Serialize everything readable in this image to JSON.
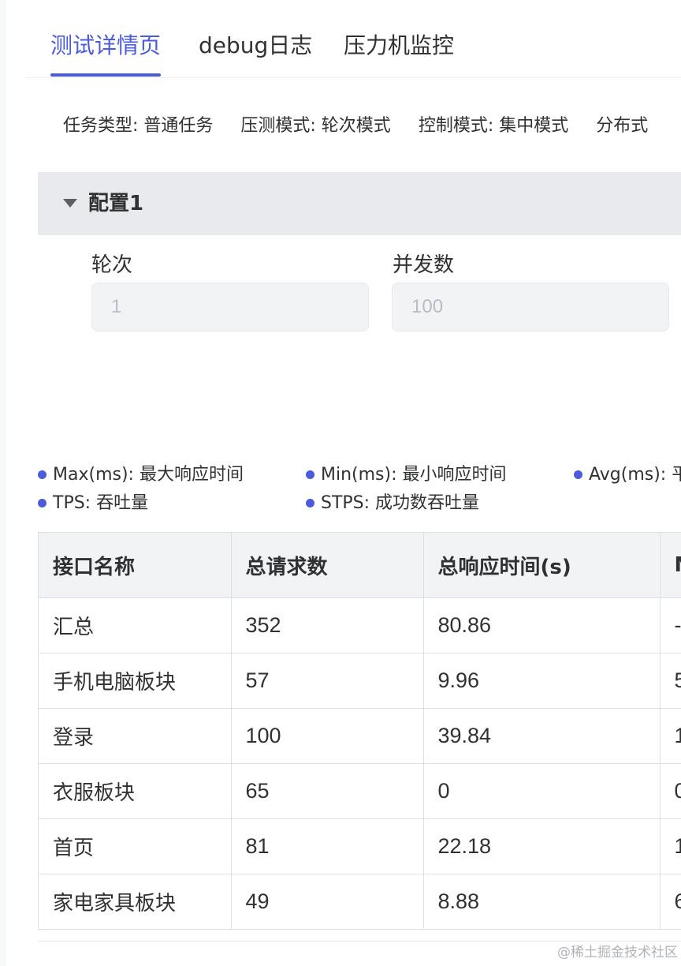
{
  "tabs": [
    {
      "label": "测试详情页",
      "active": true
    },
    {
      "label": "debug日志",
      "active": false
    },
    {
      "label": "压力机监控",
      "active": false
    }
  ],
  "meta": {
    "task_type": "任务类型: 普通任务",
    "load_mode": "压测模式: 轮次模式",
    "control_mode": "控制模式: 集中模式",
    "distribution": "分布式"
  },
  "config": {
    "title": "配置1",
    "rounds_label": "轮次",
    "rounds_value": "1",
    "concurrency_label": "并发数",
    "concurrency_value": "100"
  },
  "legend": [
    "Max(ms): 最大响应时间",
    "Min(ms): 最小响应时间",
    "Avg(ms): 平",
    "TPS: 吞吐量",
    "STPS: 成功数吞吐量"
  ],
  "table": {
    "headers": [
      "接口名称",
      "总请求数",
      "总响应时间(s)",
      "M"
    ],
    "rows": [
      [
        "汇总",
        "352",
        "80.86",
        "-"
      ],
      [
        "手机电脑板块",
        "57",
        "9.96",
        "5"
      ],
      [
        "登录",
        "100",
        "39.84",
        "1"
      ],
      [
        "衣服板块",
        "65",
        "0",
        "0"
      ],
      [
        "首页",
        "81",
        "22.18",
        "1"
      ],
      [
        "家电家具板块",
        "49",
        "8.88",
        "6"
      ]
    ]
  },
  "watermark": "@稀土掘金技术社区",
  "colors": {
    "accent": "#4a5bdc",
    "header_bg": "#e8eaed",
    "table_header_bg": "#f2f3f5"
  }
}
